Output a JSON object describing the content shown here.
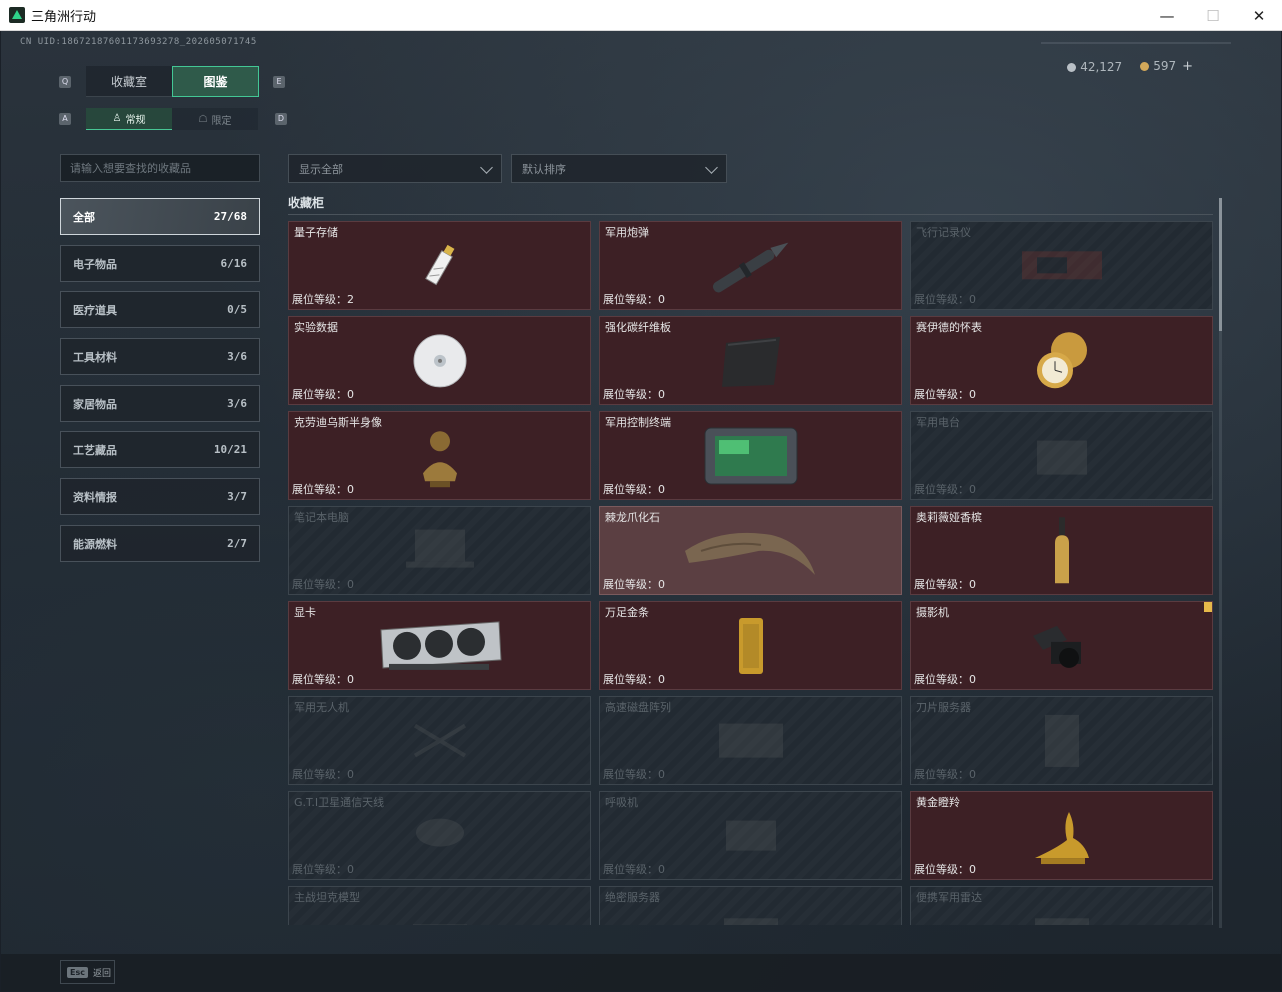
{
  "window": {
    "title": "三角洲行动",
    "minimize": "—",
    "maximize": "☐",
    "close": "✕"
  },
  "uid": "CN UID:18672187601173693278_202605071745",
  "currency": {
    "silver": "42,127",
    "gold": "597",
    "plus": "+"
  },
  "keys": {
    "q": "Q",
    "e": "E",
    "a": "A",
    "d": "D"
  },
  "tabs": {
    "tab1": "收藏室",
    "tab2": "图鉴"
  },
  "subtabs": {
    "s1": "常规",
    "s2": "限定"
  },
  "search": {
    "placeholder": "请输入想要查找的收藏品"
  },
  "categories": [
    {
      "label": "全部",
      "count": "27/68"
    },
    {
      "label": "电子物品",
      "count": "6/16"
    },
    {
      "label": "医疗道具",
      "count": "0/5"
    },
    {
      "label": "工具材料",
      "count": "3/6"
    },
    {
      "label": "家居物品",
      "count": "3/6"
    },
    {
      "label": "工艺藏品",
      "count": "10/21"
    },
    {
      "label": "资料情报",
      "count": "3/7"
    },
    {
      "label": "能源燃料",
      "count": "2/7"
    }
  ],
  "filters": {
    "show": "显示全部",
    "sort": "默认排序"
  },
  "section": {
    "title": "收藏柜"
  },
  "items": [
    {
      "name": "量子存储",
      "level": "展位等级：2",
      "icon": "usb-drive-icon",
      "unlocked": true
    },
    {
      "name": "军用炮弹",
      "level": "展位等级：0",
      "icon": "artillery-shell-icon",
      "unlocked": true
    },
    {
      "name": "飞行记录仪",
      "level": "展位等级：0",
      "icon": "flight-recorder-icon",
      "unlocked": false
    },
    {
      "name": "实验数据",
      "level": "展位等级：0",
      "icon": "data-disc-icon",
      "unlocked": true
    },
    {
      "name": "强化碳纤维板",
      "level": "展位等级：0",
      "icon": "carbon-plate-icon",
      "unlocked": true
    },
    {
      "name": "赛伊德的怀表",
      "level": "展位等级：0",
      "icon": "pocket-watch-icon",
      "unlocked": true
    },
    {
      "name": "克劳迪乌斯半身像",
      "level": "展位等级：0",
      "icon": "bust-statue-icon",
      "unlocked": true
    },
    {
      "name": "军用控制终端",
      "level": "展位等级：0",
      "icon": "control-terminal-icon",
      "unlocked": true
    },
    {
      "name": "军用电台",
      "level": "展位等级：0",
      "icon": "radio-icon",
      "unlocked": false
    },
    {
      "name": "笔记本电脑",
      "level": "展位等级：0",
      "icon": "laptop-icon",
      "unlocked": false
    },
    {
      "name": "棘龙爪化石",
      "level": "展位等级：0",
      "icon": "claw-fossil-icon",
      "unlocked": true,
      "highlight": true
    },
    {
      "name": "奥莉薇娅香槟",
      "level": "展位等级：0",
      "icon": "champagne-icon",
      "unlocked": true
    },
    {
      "name": "显卡",
      "level": "展位等级：0",
      "icon": "graphics-card-icon",
      "unlocked": true
    },
    {
      "name": "万足金条",
      "level": "展位等级：0",
      "icon": "gold-bar-icon",
      "unlocked": true
    },
    {
      "name": "摄影机",
      "level": "展位等级：0",
      "icon": "camera-icon",
      "unlocked": true,
      "badge": true
    },
    {
      "name": "军用无人机",
      "level": "展位等级：0",
      "icon": "drone-icon",
      "unlocked": false
    },
    {
      "name": "高速磁盘阵列",
      "level": "展位等级：0",
      "icon": "disk-array-icon",
      "unlocked": false
    },
    {
      "name": "刀片服务器",
      "level": "展位等级：0",
      "icon": "blade-server-icon",
      "unlocked": false
    },
    {
      "name": "G.T.I卫星通信天线",
      "level": "展位等级：0",
      "icon": "satellite-dish-icon",
      "unlocked": false
    },
    {
      "name": "呼吸机",
      "level": "展位等级：0",
      "icon": "ventilator-icon",
      "unlocked": false
    },
    {
      "name": "黄金瞪羚",
      "level": "展位等级：0",
      "icon": "gold-gazelle-icon",
      "unlocked": true
    },
    {
      "name": "主战坦克模型",
      "level": "",
      "icon": "tank-model-icon",
      "unlocked": false
    },
    {
      "name": "绝密服务器",
      "level": "",
      "icon": "server-icon",
      "unlocked": false
    },
    {
      "name": "便携军用雷达",
      "level": "",
      "icon": "radar-icon",
      "unlocked": false
    }
  ],
  "footer": {
    "key": "Esc",
    "label": "返回"
  }
}
